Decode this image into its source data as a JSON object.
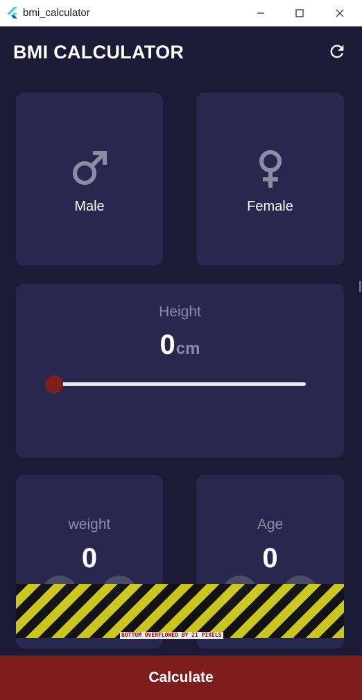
{
  "window": {
    "title": "bmi_calculator"
  },
  "appbar": {
    "title": "BMI CALCULATOR",
    "refresh_icon": "refresh-icon"
  },
  "gender": {
    "male": {
      "label": "Male",
      "icon": "male-icon"
    },
    "female": {
      "label": "Female",
      "icon": "female-icon"
    }
  },
  "height": {
    "label": "Height",
    "value": "0",
    "unit": "cm",
    "slider_value": 0
  },
  "weight": {
    "label": "weight",
    "value": "0"
  },
  "age": {
    "label": "Age",
    "value": "0"
  },
  "overflow_message": "BOTTOM OVERFLOWED BY 21 PIXELS",
  "calculate_label": "Calculate",
  "colors": {
    "background": "#1b1a37",
    "card": "#27274f",
    "accent": "#7f1d1d",
    "muted_text": "#8e8ca3"
  }
}
